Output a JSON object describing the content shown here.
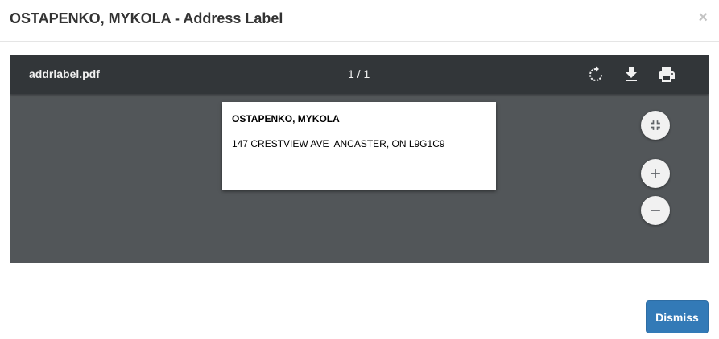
{
  "modal": {
    "title": "OSTAPENKO, MYKOLA - Address Label",
    "close_glyph": "×"
  },
  "viewer": {
    "file_name": "addrlabel.pdf",
    "page_indicator": "1 / 1",
    "toolbar_icons": [
      "rotate-icon",
      "download-icon",
      "print-icon"
    ],
    "zoom_icons": [
      "fit-to-page-icon",
      "zoom-in-icon",
      "zoom-out-icon"
    ]
  },
  "label": {
    "name": "OSTAPENKO, MYKOLA",
    "address": "147 CRESTVIEW AVE  ANCASTER, ON L9G1C9"
  },
  "footer": {
    "dismiss_label": "Dismiss"
  },
  "colors": {
    "primary_button": "#337ab7",
    "viewer_background": "#525659",
    "toolbar_background": "#323639"
  }
}
